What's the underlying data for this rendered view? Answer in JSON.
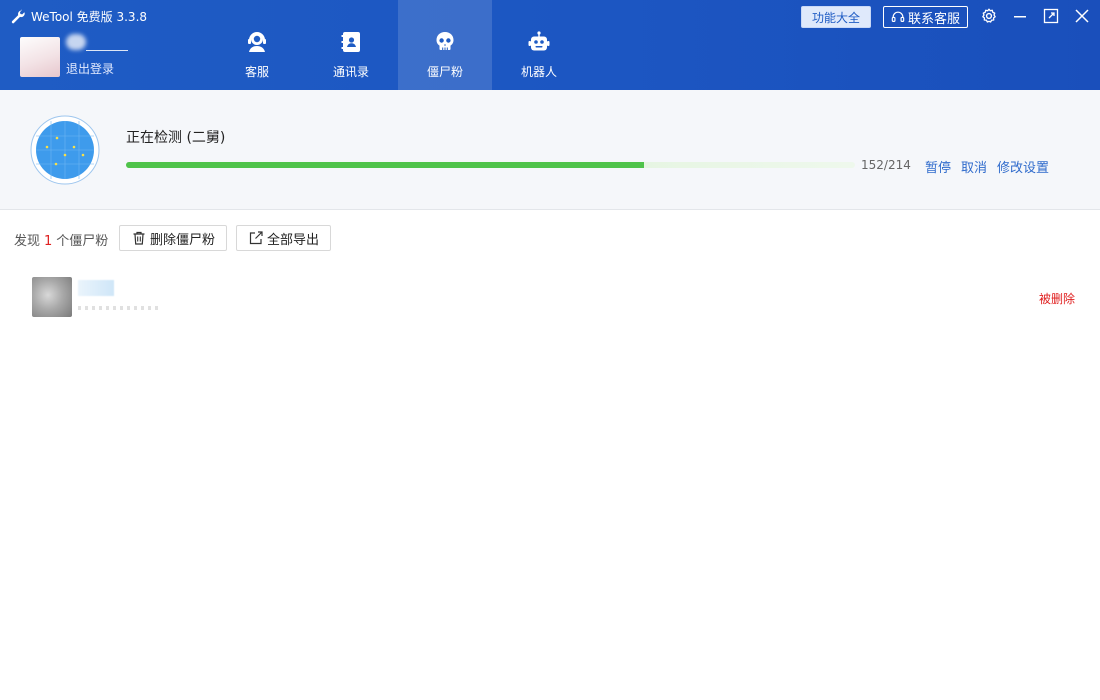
{
  "app": {
    "title": "WeTool 免费版 3.3.8"
  },
  "account": {
    "logout_label": "退出登录"
  },
  "tabs": [
    {
      "label": "客服",
      "icon": "customer-service-icon",
      "active": false
    },
    {
      "label": "通讯录",
      "icon": "contacts-icon",
      "active": false
    },
    {
      "label": "僵尸粉",
      "icon": "skull-icon",
      "active": true
    },
    {
      "label": "机器人",
      "icon": "robot-icon",
      "active": false
    }
  ],
  "header_buttons": {
    "features": "功能大全",
    "contact": "联系客服"
  },
  "detection": {
    "title": "正在检测 (二舅)",
    "progress_current": 152,
    "progress_total": 214,
    "progress_text": "152/214",
    "pause": "暂停",
    "cancel": "取消",
    "modify_settings": "修改设置"
  },
  "results": {
    "found_prefix": "发现",
    "found_count": "1",
    "found_suffix": "个僵尸粉",
    "delete_button": "删除僵尸粉",
    "export_button": "全部导出",
    "rows": [
      {
        "status": "被删除"
      }
    ]
  },
  "colors": {
    "header": "#1f5cc4",
    "accent_link": "#2f6bcc",
    "progress": "#4fc34a",
    "danger": "#e02020"
  }
}
